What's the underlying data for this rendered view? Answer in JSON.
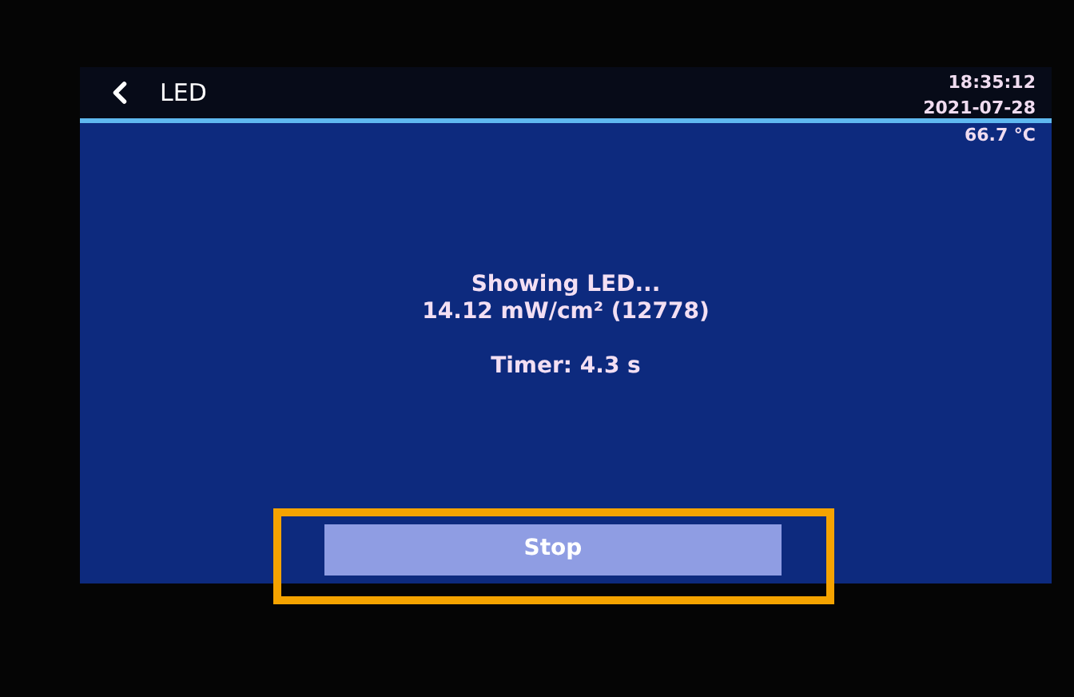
{
  "header": {
    "title": "LED",
    "time": "18:35:12",
    "date": "2021-07-28"
  },
  "temperature": "66.7 °C",
  "status": {
    "message": "Showing LED...",
    "reading": "14.12 mW/cm² (12778)",
    "timer": "Timer: 4.3 s"
  },
  "button": {
    "label": "Stop",
    "highlighted": true
  }
}
